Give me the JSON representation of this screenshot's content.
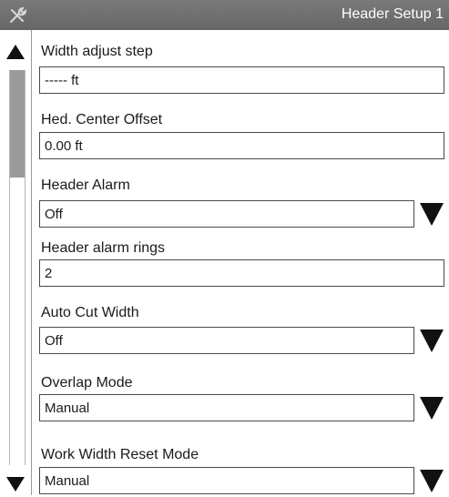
{
  "window": {
    "title": "Header Setup 1",
    "menu_icon": "wrench-screwdriver-icon",
    "bg_titlebar": "#6f6f6f"
  },
  "scrollbar": {
    "up_icon": "scroll-up-arrow-icon",
    "down_icon": "scroll-down-arrow-icon"
  },
  "fields": {
    "width_adjust_step": {
      "label": "Width adjust step",
      "value": "----- ft"
    },
    "hed_center_offset": {
      "label": "Hed. Center Offset",
      "value": "0.00 ft"
    },
    "header_alarm": {
      "label": "Header Alarm",
      "value": "Off",
      "icon": "dropdown-arrow-icon"
    },
    "header_alarm_rings": {
      "label": "Header alarm rings",
      "value": "2"
    },
    "auto_cut_width": {
      "label": "Auto Cut Width",
      "value": "Off",
      "icon": "dropdown-arrow-icon"
    },
    "overlap_mode": {
      "label": "Overlap Mode",
      "value": "Manual",
      "icon": "dropdown-arrow-icon"
    },
    "work_width_reset_mode": {
      "label": "Work Width Reset Mode",
      "value": "Manual",
      "icon": "dropdown-arrow-icon"
    }
  }
}
